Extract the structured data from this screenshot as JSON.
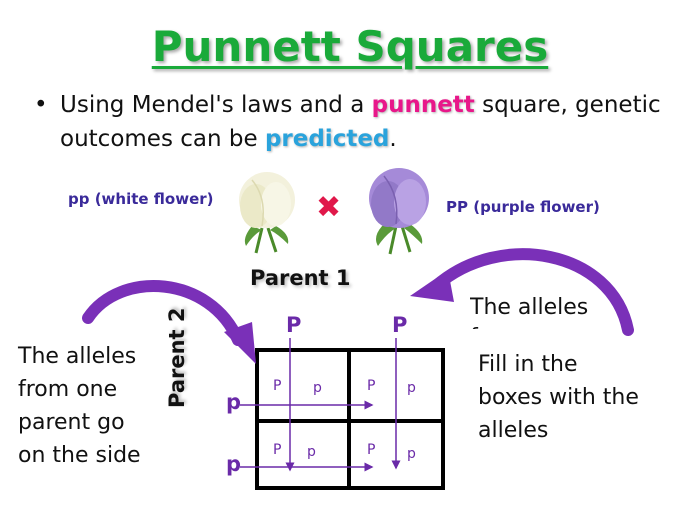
{
  "title": "Punnett Squares",
  "bullet": {
    "symbol": "•",
    "part1": "Using Mendel's laws and a ",
    "highlight1": "punnett",
    "part2": " square, genetic outcomes can be ",
    "highlight2": "predicted",
    "part3": "."
  },
  "flowers": {
    "left_label": "pp (white flower)",
    "right_label": "PP (purple flower)",
    "cross_symbol": "✖"
  },
  "parent1_label": "Parent 1",
  "parent2_label": "Parent 2",
  "top_alleles": [
    "P",
    "P"
  ],
  "side_alleles": [
    "p",
    "p"
  ],
  "cells": [
    {
      "a": "P",
      "b": "p"
    },
    {
      "a": "P",
      "b": "p"
    },
    {
      "a": "P",
      "b": "p"
    },
    {
      "a": "P",
      "b": "p"
    }
  ],
  "left_note": [
    "The alleles",
    "from one",
    "parent go",
    "on the side"
  ],
  "right_note_top": "The alleles from one",
  "right_note": [
    "Fill in the",
    "boxes with the",
    "alleles"
  ],
  "colors": {
    "title": "#1aaa3a",
    "pink": "#e8178a",
    "blue": "#2aa3dc",
    "arrow": "#6a2aa8"
  }
}
